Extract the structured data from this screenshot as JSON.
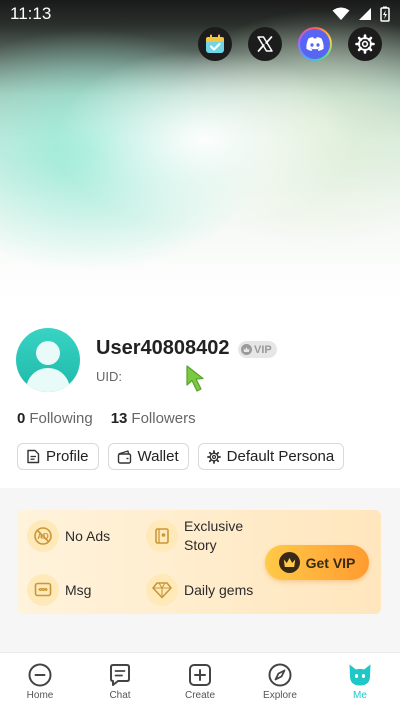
{
  "status_bar": {
    "time": "11:13"
  },
  "top_actions": [
    {
      "name": "calendar-checkin",
      "icon": "calendar-check-icon"
    },
    {
      "name": "x-twitter",
      "icon": "x-logo-icon"
    },
    {
      "name": "discord",
      "icon": "discord-icon"
    },
    {
      "name": "settings",
      "icon": "gear-icon"
    }
  ],
  "profile": {
    "username": "User40808402",
    "vip_label": "VIP",
    "uid_label": "UID:",
    "following_count": "0",
    "following_label": "Following",
    "followers_count": "13",
    "followers_label": "Followers"
  },
  "chips": {
    "profile": "Profile",
    "wallet": "Wallet",
    "persona": "Default Persona"
  },
  "vip_card": {
    "perks": {
      "no_ads": "No Ads",
      "exclusive_line1": "Exclusive",
      "exclusive_line2": "Story",
      "msg": "Msg",
      "daily_gems": "Daily gems"
    },
    "button": "Get VIP"
  },
  "nav": {
    "home": "Home",
    "chat": "Chat",
    "create": "Create",
    "explore": "Explore",
    "me": "Me"
  },
  "colors": {
    "accent": "#1fc7c7",
    "vip_gold": "#ffb23c",
    "discord": "#5865f2"
  }
}
